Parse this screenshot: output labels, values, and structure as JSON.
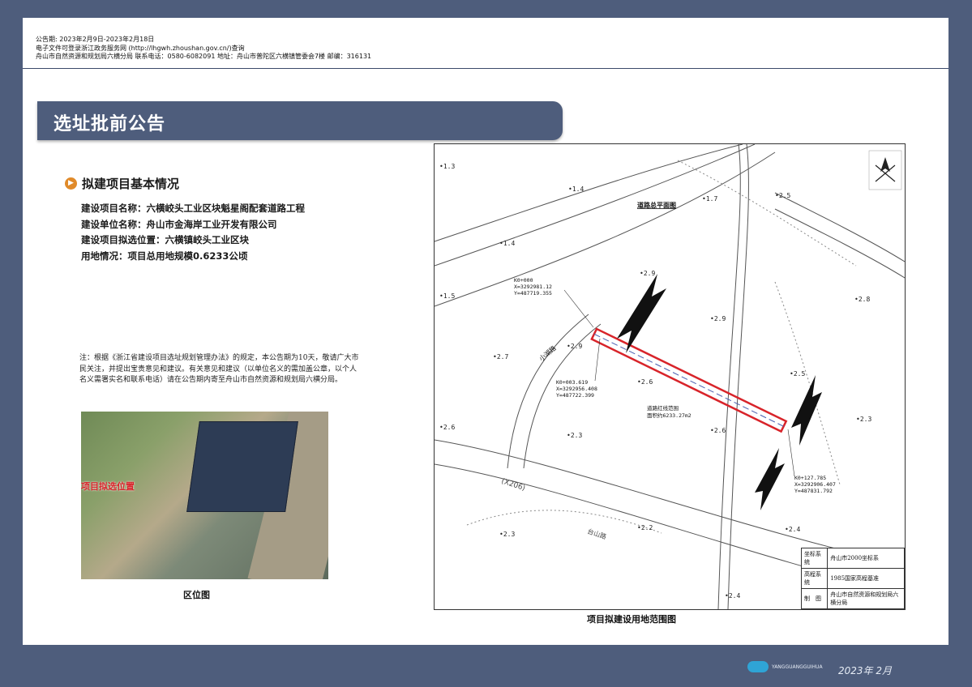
{
  "header": {
    "line1": "公告期:  2023年2月9日-2023年2月18日",
    "line2": "电子文件可登录浙江政务服务网 (http://lhgwh.zhoushan.gov.cn/)查询",
    "line3": "舟山市自然资源和规划局六横分局    联系电话：0580-6082091    地址：舟山市普陀区六横镇管委会7楼    邮编：316131"
  },
  "title": "选址批前公告",
  "section": {
    "heading": "拟建项目基本情况",
    "items": [
      "建设项目名称：六横峧头工业区块魁星阁配套道路工程",
      "建设单位名称：舟山市金海岸工业开发有限公司",
      "建设项目拟选位置：六横镇峧头工业区块",
      "用地情况：项目总用地规模0.6233公顷"
    ]
  },
  "note": "注：根据《浙江省建设项目选址规划管理办法》的规定，本公告期为10天，敬请广大市民关注，并提出宝贵意见和建议。有关意见和建议（以单位名义的需加盖公章，以个人名义需署实名和联系电话）请在公告期内寄至舟山市自然资源和规划局六横分局。",
  "location_map": {
    "marker": "项目拟选位置",
    "caption": "区位图"
  },
  "site_map": {
    "caption": "项目拟建设用地范围图",
    "plan_title": "道路总平面图",
    "road_name": "小湖路",
    "road_x206": "(X206)",
    "road_label_2": "台山路",
    "start_point": [
      "K0+000",
      "X=3292981.12",
      "Y=487719.355"
    ],
    "mid_point": [
      "K0+003.619",
      "X=3292956.408",
      "Y=487722.399"
    ],
    "end_point": [
      "K0+127.785",
      "X=3292906.407",
      "Y=487831.792"
    ],
    "area_note": [
      "道路红线范围",
      "面积约6233.27m2"
    ],
    "elevations": [
      "1.3",
      "1.4",
      "1.4",
      "1.5",
      "2.7",
      "1.7",
      "2.5",
      "2.9",
      "2.9",
      "2.9",
      "2.8",
      "2.6",
      "2.5",
      "2.3",
      "2.6",
      "2.3",
      "2.2",
      "2.3",
      "2.4",
      "2.4",
      "2.6"
    ],
    "legend": [
      {
        "label": "坐标系统",
        "value": "舟山市2000坐标系"
      },
      {
        "label": "高程系统",
        "value": "1985国家高程基准"
      },
      {
        "label": "制　图",
        "value": "舟山市自然资源和规划局六横分局"
      }
    ]
  },
  "footer": {
    "brand": "YANGGUANGGUIHUA",
    "date": "2023年 2月"
  },
  "colors": {
    "frame": "#4e5d7c",
    "accent": "#e08a2a",
    "redline": "#d8242a"
  }
}
